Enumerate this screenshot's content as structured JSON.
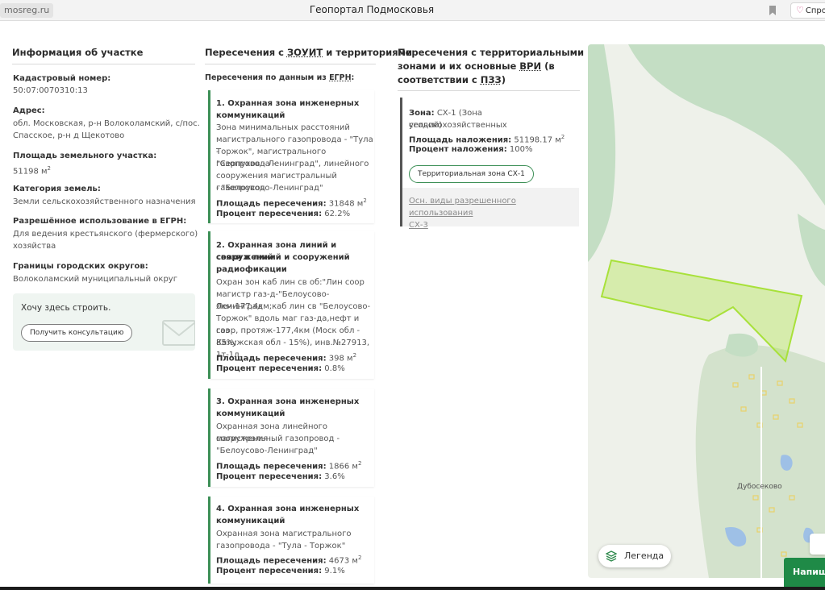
{
  "browser": {
    "url": "mosreg.ru",
    "title": "Геопортал Подмосковья",
    "tab_label": "Спро"
  },
  "info": {
    "title": "Информация об участке",
    "cadastral_label": "Кадастровый номер:",
    "cadastral_value": "50:07:0070310:13",
    "address_label": "Адрес:",
    "address_line1": "обл. Московская, р-н Волоколамский, с/пос.",
    "address_line2": "Спасское, р-н д Щекотово",
    "area_label": "Площадь земельного участка:",
    "area_value": "51198 м",
    "area_sup": "2",
    "category_label": "Категория земель:",
    "category_value": "Земли сельскохозяйственного назначения",
    "usage_label": "Разрешённое использование в ЕГРН:",
    "usage_line1": "Для ведения крестьянского (фермерского)",
    "usage_line2": "хозяйства",
    "borders_label": "Границы городских округов:",
    "borders_value": "Волоколамский муниципальный округ",
    "consult_title": "Хочу здесь строить.",
    "consult_button": "Получить консультацию"
  },
  "zouit": {
    "title_prefix": "Пересечения с ",
    "title_abbr": "ЗОУИТ",
    "title_suffix": " и территориями",
    "subtitle_prefix": "Пересечения по данным из ",
    "subtitle_abbr": "ЕГРН",
    "subtitle_suffix": ":",
    "area_label": "Площадь пересечения:",
    "percent_label": "Процент пересечения:",
    "unit": "м",
    "unit_sup": "2",
    "cards": [
      {
        "title1": "1. Охранная зона инженерных",
        "title2": "коммуникаций",
        "d1": "Зона минимальных расстояний",
        "d2": "магистрального газопровода - \"Тула -",
        "d3": "Торжок\", магистрального газопровода -",
        "d4": "\"Серпухов - Ленинград\", линейного",
        "d5": "сооружения магистральный газопровод",
        "d6": "- \"Белоусово-Ленинград\"",
        "area": "31848",
        "percent": "62.2%"
      },
      {
        "title1": "2. Охранная зона линий и сооружений",
        "title2": "связи и линий и сооружений",
        "title3": "радиофикации",
        "d1": "Охран зон каб лин св об:\"Лин соор",
        "d2": "магистр газ-д-\"Белоусово-Ленинград",
        "d3": "0км-177,4км;каб лин св \"Белоусово-",
        "d4": "Торжок\" вдоль маг газ-да,нефт и газ",
        "d5": "соор, протяж-177,4км (Моск обл - 85%;",
        "d6": "Калужская обл - 15%), инв.№27913, 1т-1л.",
        "area": "398",
        "percent": "0.8%"
      },
      {
        "title1": "3. Охранная зона инженерных",
        "title2": "коммуникаций",
        "d1": "Охранная зона линейного сооружения",
        "d2": "магистральный газопровод -",
        "d3": "\"Белоусово-Ленинград\"",
        "area": "1866",
        "percent": "3.6%"
      },
      {
        "title1": "4. Охранная зона инженерных",
        "title2": "коммуникаций",
        "d1": "Охранная зона магистрального",
        "d2": "газопровода - \"Тула - Торжок\"",
        "area": "4673",
        "percent": "9.1%"
      }
    ]
  },
  "zones": {
    "title1": "Пересечения с территориальными",
    "title2_prefix": "зонами и их основные ",
    "title2_abbr": "ВРИ",
    "title2_suffix": " (в",
    "title3_prefix": "соответствии с ",
    "title3_abbr": "ПЗЗ",
    "title3_suffix": ")",
    "zone_label": "Зона:",
    "zone_value1": " СХ-1 (Зона сельскохозяйственных",
    "zone_value2": "угодий)",
    "overlap_area_label": "Площадь наложения:",
    "overlap_area_value": " 51198.17 м",
    "overlap_sup": "2",
    "overlap_percent_label": "Процент наложения:",
    "overlap_percent_value": " 100%",
    "zone_button": "Территориальная зона СХ-1",
    "sub_link1": "Осн. виды разрешенного использования",
    "sub_link2": "СХ-3"
  },
  "map": {
    "village_label": "Дубосеково",
    "legend_button": "Легенда",
    "write_button": "Напиши",
    "parcel_color": "#a8e13a",
    "forest_color": "#c4dec4",
    "field_color": "#eef1ea"
  }
}
